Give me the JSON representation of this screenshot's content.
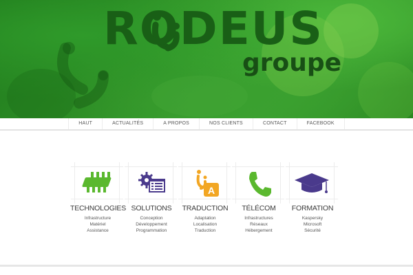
{
  "brand": {
    "logo": "RODEUS",
    "subtitle": "groupe"
  },
  "nav": {
    "items": [
      {
        "label": "HAUT"
      },
      {
        "label": "ACTUALITÉS"
      },
      {
        "label": "A PROPOS"
      },
      {
        "label": "NOS CLIENTS"
      },
      {
        "label": "CONTACT"
      },
      {
        "label": "FACEBOOK"
      }
    ]
  },
  "services": [
    {
      "title": "TECHNOLOGIES",
      "icon": "chip-icon",
      "lines": [
        "Infrastructure",
        "Matériel",
        "Assistance"
      ]
    },
    {
      "title": "SOLUTIONS",
      "icon": "gear-window-icon",
      "lines": [
        "Conception",
        "Développement",
        "Programmation"
      ]
    },
    {
      "title": "TRADUCTION",
      "icon": "translate-icon",
      "lines": [
        "Adaptation",
        "Localisation",
        "Traduction"
      ]
    },
    {
      "title": "TÉLÉCOM",
      "icon": "phone-icon",
      "lines": [
        "Infrastructures",
        "Réseaux",
        "Hébergement"
      ]
    },
    {
      "title": "FORMATION",
      "icon": "graduation-cap-icon",
      "lines": [
        "Kaspersky",
        "Microsoft",
        "Sécurité"
      ]
    }
  ],
  "colors": {
    "banner_green": "#2e8f26",
    "logo_dark_green": "#195f16",
    "icon_green": "#5ab82e",
    "icon_purple": "#4a3a8c",
    "icon_orange": "#f2a623"
  }
}
